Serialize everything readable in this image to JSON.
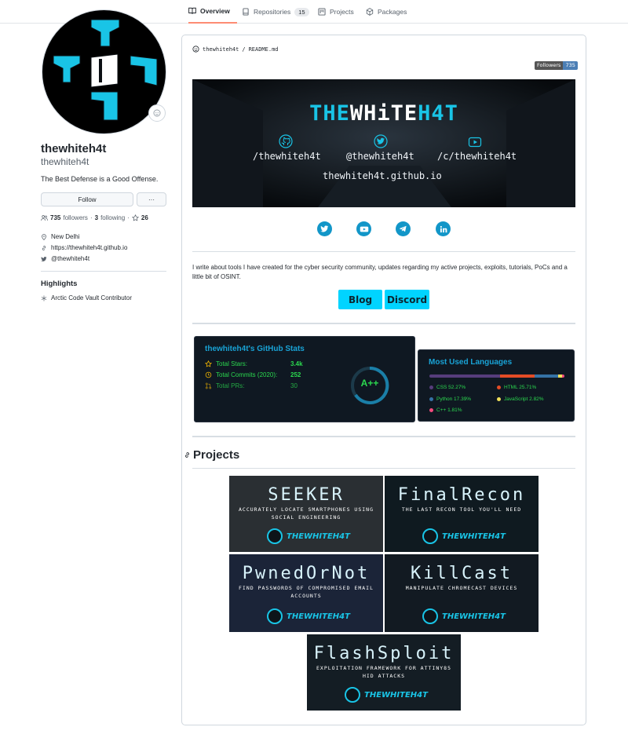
{
  "tabs": [
    {
      "label": "Overview",
      "count": null
    },
    {
      "label": "Repositories",
      "count": "15"
    },
    {
      "label": "Projects",
      "count": null
    },
    {
      "label": "Packages",
      "count": null
    }
  ],
  "profile": {
    "name": "thewhiteh4t",
    "login": "thewhiteh4t",
    "bio": "The Best Defense is a Good Offense.",
    "follow_label": "Follow",
    "more_label": "···",
    "followers_count": "735",
    "followers_label": "followers",
    "following_count": "3",
    "following_label": "following",
    "stars_count": "26",
    "location": "New Delhi",
    "website": "https://thewhiteh4t.github.io",
    "twitter": "@thewhiteh4t",
    "highlights_title": "Highlights",
    "highlight_item": "Arctic Code Vault Contributor"
  },
  "readme": {
    "path_user": "thewhiteh4t",
    "path_sep": "/",
    "path_file": "README.md",
    "badge_label": "Followers",
    "badge_value": "735",
    "banner_title_a": "THE",
    "banner_title_b": "WHiTE",
    "banner_title_c": "H4T",
    "banner_github": "/thewhiteh4t",
    "banner_twitter": "@thewhiteh4t",
    "banner_youtube": "/c/thewhiteh4t",
    "banner_site": "thewhiteh4t.github.io",
    "description": "I write about tools I have created for the cyber security community, updates regarding my active projects, exploits, tutorials, PoCs and a little bit of OSINT.",
    "blog_label": "Blog",
    "discord_label": "Discord"
  },
  "stats_card": {
    "title": "thewhiteh4t's GitHub Stats",
    "rows": [
      {
        "label": "Total Stars:",
        "value": "3.4k"
      },
      {
        "label": "Total Commits (2020):",
        "value": "252"
      },
      {
        "label": "Total PRs:",
        "value": "30"
      }
    ],
    "grade": "A++"
  },
  "lang_card": {
    "title": "Most Used Languages",
    "langs": [
      {
        "label": "CSS 52.27%",
        "color": "#563d7c",
        "share": 52.27
      },
      {
        "label": "HTML 25.71%",
        "color": "#e34c26",
        "share": 25.71
      },
      {
        "label": "Python 17.39%",
        "color": "#3572a5",
        "share": 17.39
      },
      {
        "label": "JavaScript 2.82%",
        "color": "#f1e05a",
        "share": 2.82
      },
      {
        "label": "C++ 1.81%",
        "color": "#f34b7d",
        "share": 1.81
      }
    ]
  },
  "projects": {
    "heading": "Projects",
    "logo_text": "THEWHITEH4T",
    "items": [
      {
        "title": "SEEKER",
        "subtitle": "ACCURATELY LOCATE SMARTPHONES USING SOCIAL ENGINEERING"
      },
      {
        "title": "FinalRecon",
        "subtitle": "THE LAST RECON TOOL YOU'LL NEED"
      },
      {
        "title": "PwnedOrNot",
        "subtitle": "FIND PASSWORDS OF COMPROMISED EMAIL ACCOUNTS"
      },
      {
        "title": "KillCast",
        "subtitle": "MANIPULATE CHROMECAST DEVICES"
      },
      {
        "title": "FlashSploit",
        "subtitle": "EXPLOITATION FRAMEWORK FOR ATTINY85 HID ATTACKS"
      }
    ]
  },
  "colors": {
    "accent_cyan": "#19c4e6",
    "tab_underline": "#fd8c73",
    "stats_green": "#2bd94f"
  }
}
